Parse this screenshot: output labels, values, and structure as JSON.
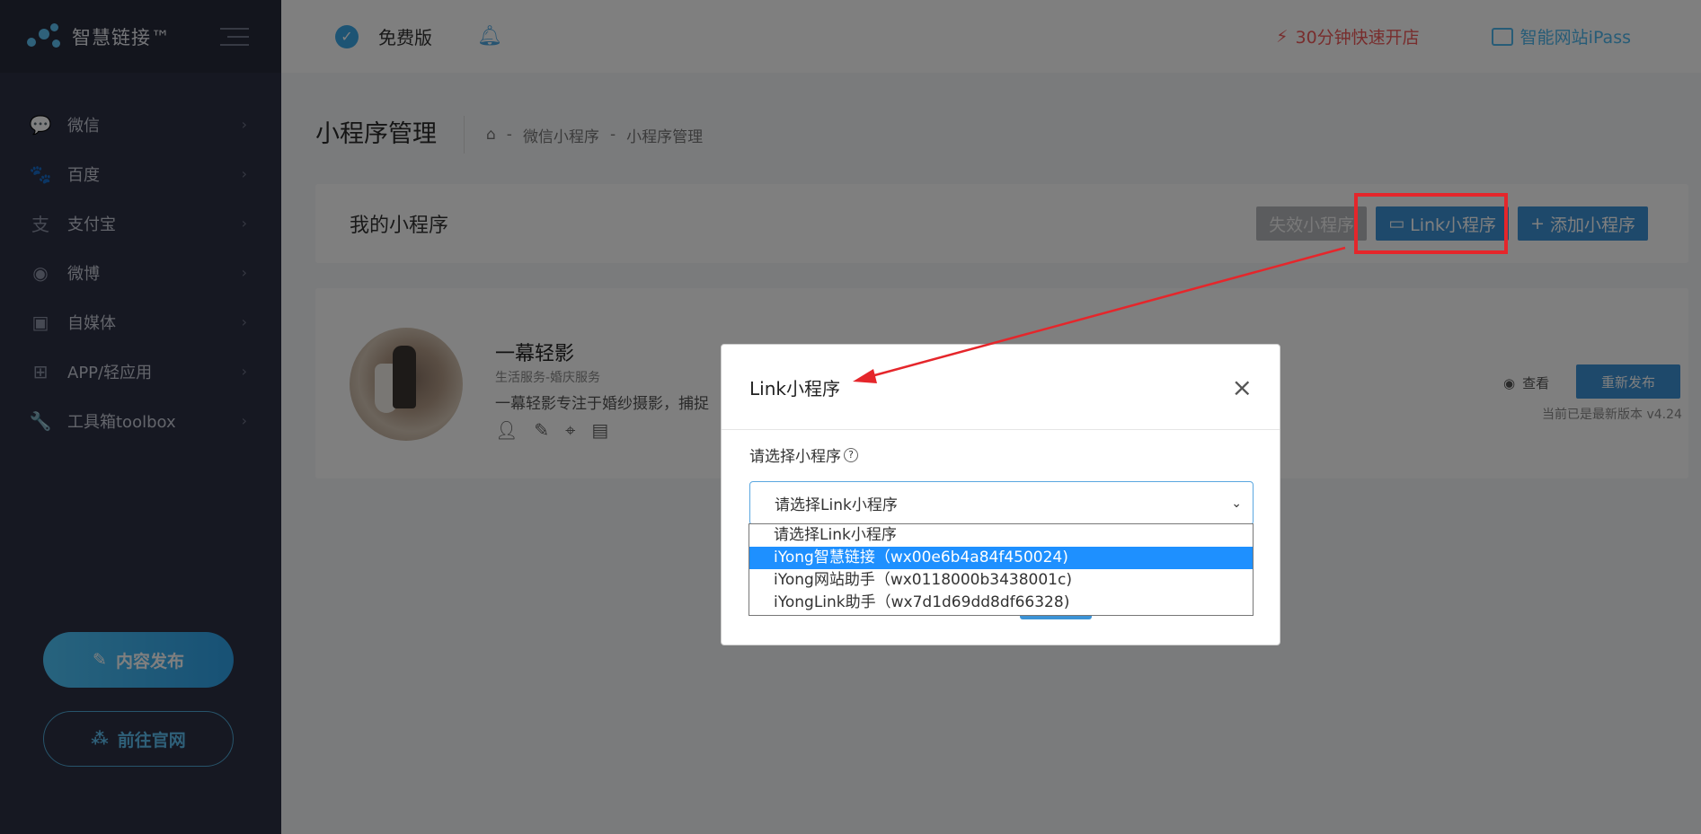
{
  "brand": {
    "name": "智慧链接™"
  },
  "sidebar": {
    "items": [
      {
        "label": "微信",
        "icon": "wechat-icon",
        "glyph": "💬"
      },
      {
        "label": "百度",
        "icon": "paw-icon",
        "glyph": "🐾"
      },
      {
        "label": "支付宝",
        "icon": "alipay-icon",
        "glyph": "支"
      },
      {
        "label": "微博",
        "icon": "weibo-icon",
        "glyph": "◉"
      },
      {
        "label": "自媒体",
        "icon": "camera-icon",
        "glyph": "▣"
      },
      {
        "label": "APP/轻应用",
        "icon": "app-grid-icon",
        "glyph": "⊞"
      },
      {
        "label": "工具箱toolbox",
        "icon": "wrench-icon",
        "glyph": "🔧"
      }
    ],
    "publish_label": "内容发布",
    "site_label": "前往官网"
  },
  "topbar": {
    "plan_label": "免费版",
    "quick_open_label": "30分钟快速开店",
    "ipass_label": "智能网站iPass"
  },
  "page": {
    "title": "小程序管理",
    "breadcrumb": [
      "微信小程序",
      "小程序管理"
    ]
  },
  "section": {
    "title": "我的小程序",
    "invalid_btn": "失效小程序",
    "link_btn": "Link小程序",
    "add_btn": "添加小程序"
  },
  "app": {
    "name": "一幕轻影",
    "category": "生活服务-婚庆服务",
    "description": "一幕轻影专注于婚纱摄影，捕捉",
    "view_label": "查看",
    "republish_label": "重新发布",
    "version_text": "当前已是最新版本 v4.24"
  },
  "modal": {
    "title": "Link小程序",
    "field_label": "请选择小程序",
    "select_value": "请选择Link小程序",
    "options": [
      "请选择Link小程序",
      "iYong智慧链接（wx00e6b4a84f450024)",
      "iYong网站助手（wx0118000b3438001c)",
      "iYongLink助手（wx7d1d69dd8df66328)"
    ],
    "highlighted_option_index": 1
  },
  "colors": {
    "sidebar_bg": "#2c3045",
    "accent_blue": "#3c93d6",
    "quick_open_red": "#f05a5a",
    "annotation_red": "#e5262b",
    "selected_option": "#1e90ff"
  }
}
